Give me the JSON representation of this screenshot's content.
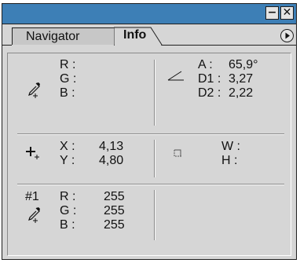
{
  "tabs": {
    "navigator": "Navigator",
    "info": "Info"
  },
  "color1": {
    "labels": [
      "R :",
      "G :",
      "B :"
    ],
    "values": [
      "",
      "",
      ""
    ]
  },
  "angle": {
    "labels": [
      "A :",
      "D1 :",
      "D2 :"
    ],
    "values": [
      "65,9°",
      "3,27",
      "2,22"
    ]
  },
  "position": {
    "labels": [
      "X :",
      "Y :"
    ],
    "values": [
      "4,13",
      "4,80"
    ]
  },
  "size": {
    "labels": [
      "W :",
      "H :"
    ],
    "values": [
      "",
      ""
    ]
  },
  "sample": {
    "id": "#1",
    "labels": [
      "R :",
      "G :",
      "B :"
    ],
    "values": [
      "255",
      "255",
      "255"
    ]
  },
  "titlebar": {
    "minimize_glyph": "−",
    "close_glyph": "✕"
  }
}
